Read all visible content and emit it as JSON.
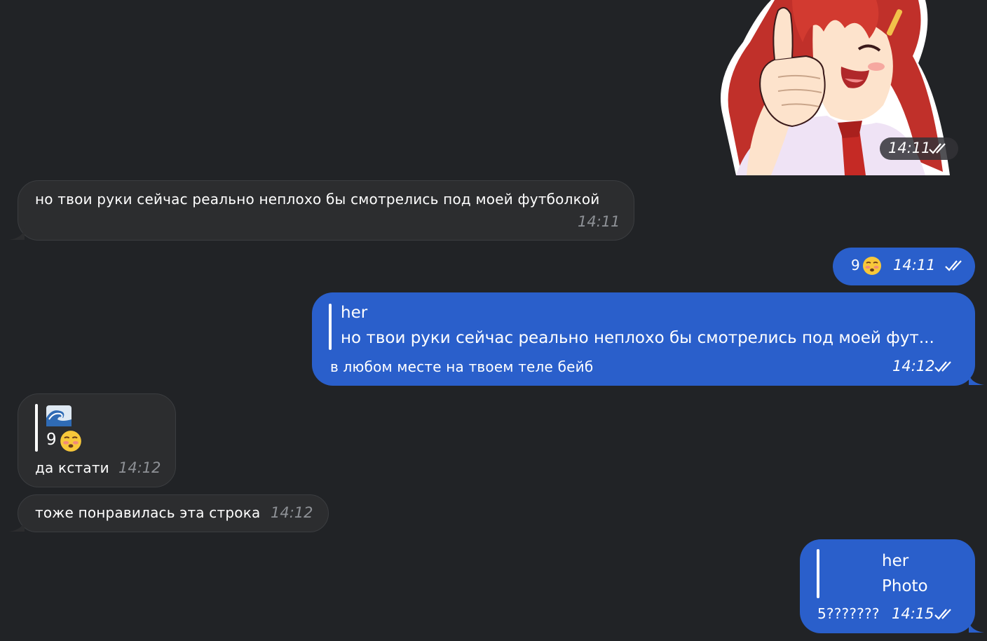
{
  "chat": {
    "sticker": {
      "time": "14:11",
      "icon": "anime-girl-thumbs-up-sticker"
    },
    "messages": [
      {
        "direction": "incoming",
        "text": "но твои руки сейчас реально неплохо бы смотрелись под моей футболкой",
        "time": "14:11"
      },
      {
        "direction": "outgoing",
        "text": "9",
        "emoji": "flushed-face-emoji",
        "time": "14:11"
      },
      {
        "direction": "outgoing",
        "reply_to": {
          "name": "her",
          "text": "но твои руки сейчас реально неплохо бы смотрелись под моей фут..."
        },
        "text": "в любом месте на твоем теле бейб",
        "time": "14:12"
      },
      {
        "direction": "incoming",
        "reply_to": {
          "emoji": "wave-emoji",
          "text": "9",
          "text_emoji": "flushed-face-emoji"
        },
        "text": "да кстати",
        "time": "14:12"
      },
      {
        "direction": "incoming",
        "text": "тоже понравилась эта строка",
        "time": "14:12"
      },
      {
        "direction": "outgoing",
        "reply_to": {
          "name": "her",
          "text": "Photo"
        },
        "text": "5???????",
        "time": "14:15"
      }
    ]
  },
  "colors": {
    "background": "#212326",
    "incoming_bubble": "#2c2d2f",
    "outgoing_bubble": "#2a5fcb",
    "time_incoming": "#8e9196"
  }
}
